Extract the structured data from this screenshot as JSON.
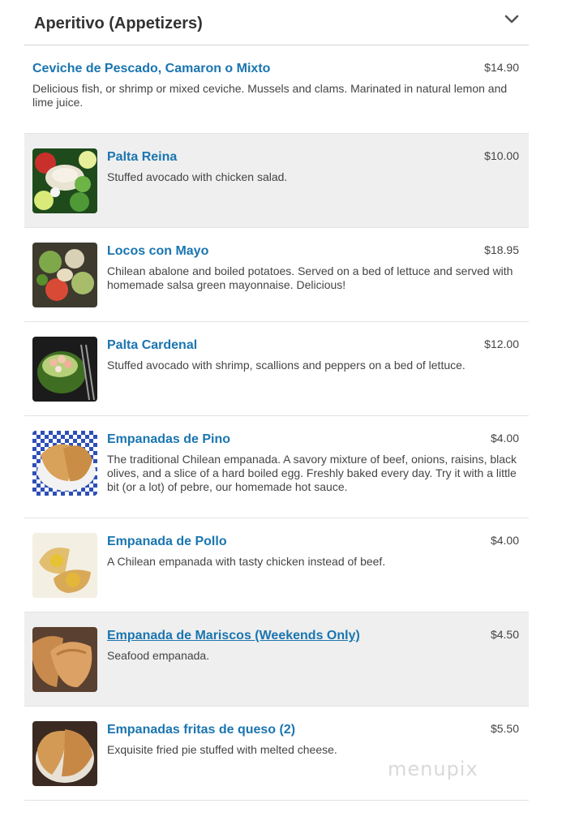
{
  "section": {
    "title": "Aperitivo (Appetizers)",
    "toggle_icon": "chevron-down-icon"
  },
  "items": [
    {
      "name": "Ceviche de Pescado, Camaron o Mixto",
      "price": "$14.90",
      "desc": "Delicious fish, or shrimp or mixed ceviche. Mussels and clams. Marinated in natural lemon and lime juice.",
      "image": null
    },
    {
      "name": "Palta Reina",
      "price": "$10.00",
      "desc": "Stuffed avocado with chicken salad.",
      "image": "palta-reina-photo"
    },
    {
      "name": "Locos con Mayo",
      "price": "$18.95",
      "desc": "Chilean abalone and boiled potatoes. Served on a bed of lettuce and served with homemade salsa green mayonnaise. Delicious!",
      "image": "locos-con-mayo-photo"
    },
    {
      "name": "Palta Cardenal",
      "price": "$12.00",
      "desc": "Stuffed avocado with shrimp, scallions and peppers on a bed of lettuce.",
      "image": "palta-cardenal-photo"
    },
    {
      "name": "Empanadas de Pino",
      "price": "$4.00",
      "desc": "The traditional Chilean empanada. A savory mixture of beef, onions, raisins, black olives, and a slice of a hard boiled egg. Freshly baked every day. Try it with a little bit (or a lot) of pebre, our homemade hot sauce.",
      "image": "empanadas-de-pino-photo"
    },
    {
      "name": "Empanada de Pollo",
      "price": "$4.00",
      "desc": "A Chilean empanada with tasty chicken instead of beef.",
      "image": "empanada-de-pollo-photo"
    },
    {
      "name": "Empanada de Mariscos (Weekends Only)",
      "price": "$4.50",
      "desc": "Seafood empanada.",
      "image": "empanada-de-mariscos-photo"
    },
    {
      "name": "Empanadas fritas de queso (2)",
      "price": "$5.50",
      "desc": "Exquisite fried pie stuffed with melted cheese.",
      "image": "empanadas-fritas-photo"
    }
  ],
  "watermark": "menupix",
  "colors": {
    "item_name": "#1a75b0",
    "hover_row": "#efefef",
    "divider": "#e3e3e3"
  }
}
